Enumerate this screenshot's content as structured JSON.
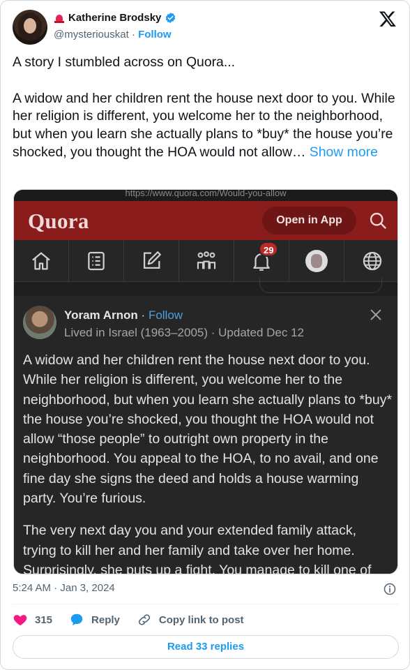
{
  "author": {
    "name": "Katherine Brodsky",
    "handle": "@mysteriouskat",
    "separator": "·",
    "follow_label": "Follow",
    "avatar": "profile-photo",
    "emoji": "police-siren-icon",
    "verified": "verified-badge-icon"
  },
  "platform_logo": "x-logo-icon",
  "tweet": {
    "paragraphs": [
      "A story I stumbled across on Quora...",
      "A widow and her children rent the house next door to you. While her religion is different, you welcome her to the neighborhood, but when you learn she actually plans to *buy* the house you’re shocked, you thought the HOA would not allow…"
    ],
    "show_more": "Show more"
  },
  "embedded_image": {
    "url_strip": "https://www.quora.com/Would-you-allow",
    "quora": {
      "logo_text": "Quora",
      "open_in_app": "Open in App",
      "nav_icons": [
        "home-icon",
        "answers-icon",
        "write-icon",
        "spaces-icon",
        "notifications-icon",
        "profile-icon",
        "language-icon"
      ],
      "notification_count": "29",
      "post": {
        "author": "Yoram Arnon",
        "separator": "·",
        "follow_label": "Follow",
        "meta": "Lived in Israel (1963–2005) · Updated Dec 12",
        "paragraphs": [
          "A widow and her children rent the house next door to you. While her religion is different, you welcome her to the neighborhood, but when you learn she actually plans to *buy* the house you’re shocked, you thought the HOA would not allow “those people” to outright own property in the neighborhood. You appeal to the HOA, to no avail, and one fine day she signs the deed and holds a house warming party. You’re furious.",
          "The very next day you and your extended family attack, trying to kill her and her family and take over her home. Surprisingly, she puts up a fight. You manage to kill one of"
        ]
      }
    }
  },
  "footer": {
    "timestamp": "5:24 AM · Jan 3, 2024",
    "likes": "315",
    "reply_label": "Reply",
    "copy_link_label": "Copy link to post",
    "read_replies": "Read 33 replies"
  },
  "colors": {
    "x_blue": "#1d9bf0",
    "like_pink": "#f91880",
    "quora_red": "#8b1c1c",
    "quora_dark": "#262626"
  }
}
